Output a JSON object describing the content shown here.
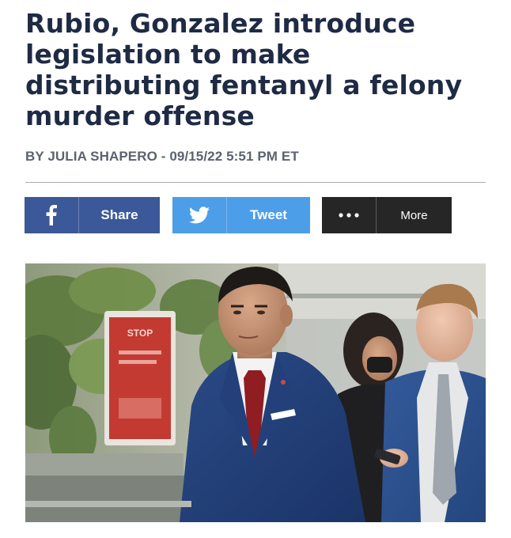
{
  "article": {
    "headline": "Rubio, Gonzalez introduce legislation to make distributing fentanyl a felony murder offense",
    "byline": "BY JULIA SHAPERO - 09/15/22 5:51 PM ET"
  },
  "share_bar": {
    "facebook": {
      "label": "Share",
      "icon": "facebook-icon",
      "color": "#3b5998"
    },
    "twitter": {
      "label": "Tweet",
      "icon": "twitter-bird-icon",
      "color": "#4d9ee8"
    },
    "more": {
      "label": "More",
      "icon": "ellipsis-icon",
      "color": "#262626"
    }
  },
  "photo": {
    "sign_text": "STOP"
  }
}
